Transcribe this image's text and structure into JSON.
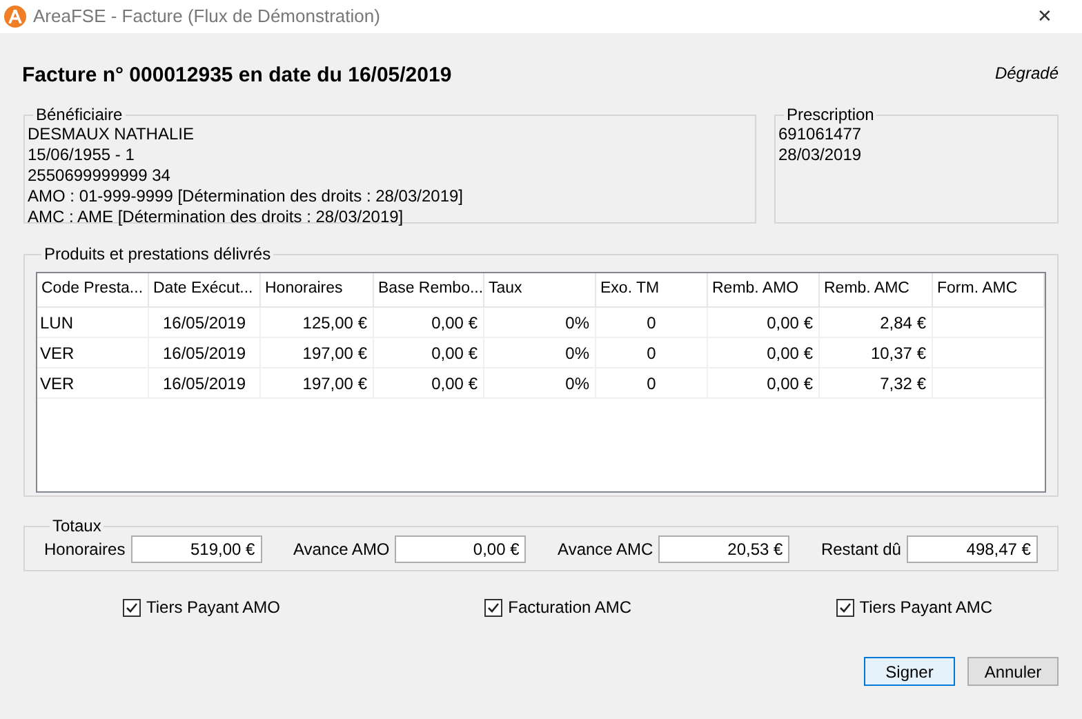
{
  "window": {
    "title": "AreaFSE - Facture (Flux de Démonstration)",
    "close": "✕"
  },
  "header": {
    "title": "Facture n° 000012935 en date du 16/05/2019",
    "mode": "Dégradé"
  },
  "beneficiaire": {
    "title": "Bénéficiaire",
    "lines": [
      "DESMAUX NATHALIE",
      "15/06/1955 - 1",
      "2550699999999 34",
      "AMO : 01-999-9999 [Détermination des droits : 28/03/2019]",
      "AMC : AME [Détermination des droits : 28/03/2019]"
    ]
  },
  "prescription": {
    "title": "Prescription",
    "lines": [
      "691061477",
      "28/03/2019"
    ]
  },
  "produits": {
    "title": "Produits et prestations délivrés",
    "table": {
      "columns": [
        "Code Presta...",
        "Date Exécut...",
        "Honoraires",
        "Base Rembo...",
        "Taux",
        "Exo. TM",
        "Remb. AMO",
        "Remb. AMC",
        "Form. AMC"
      ],
      "rows": [
        [
          "LUN",
          "16/05/2019",
          "125,00 €",
          "0,00 €",
          "0%",
          "0",
          "0,00 €",
          "2,84 €",
          ""
        ],
        [
          "VER",
          "16/05/2019",
          "197,00 €",
          "0,00 €",
          "0%",
          "0",
          "0,00 €",
          "10,37 €",
          ""
        ],
        [
          "VER",
          "16/05/2019",
          "197,00 €",
          "0,00 €",
          "0%",
          "0",
          "0,00 €",
          "7,32 €",
          ""
        ]
      ]
    }
  },
  "totaux": {
    "title": "Totaux",
    "fields": [
      {
        "label": "Honoraires",
        "value": "519,00 €"
      },
      {
        "label": "Avance AMO",
        "value": "0,00 €"
      },
      {
        "label": "Avance AMC",
        "value": "20,53 €"
      },
      {
        "label": "Restant dû",
        "value": "498,47 €"
      }
    ]
  },
  "options": [
    {
      "label": "Tiers Payant AMO",
      "checked": true
    },
    {
      "label": "Facturation AMC",
      "checked": true
    },
    {
      "label": "Tiers Payant AMC",
      "checked": true
    }
  ],
  "buttons": [
    {
      "label": "Signer",
      "default": true
    },
    {
      "label": "Annuler",
      "default": false
    }
  ]
}
